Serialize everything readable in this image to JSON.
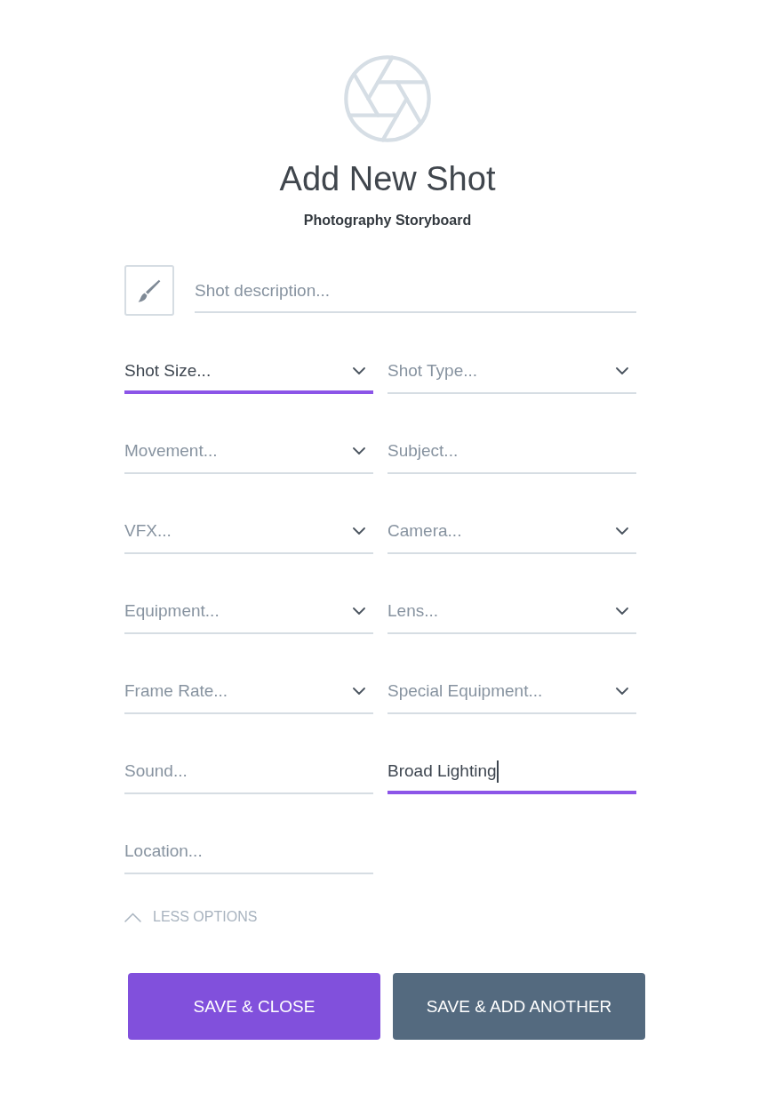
{
  "header": {
    "title": "Add New Shot",
    "subtitle": "Photography Storyboard"
  },
  "description": {
    "placeholder": "Shot description..."
  },
  "fields": [
    {
      "kind": "select",
      "placeholder": "Shot Size...",
      "focused": true
    },
    {
      "kind": "select",
      "placeholder": "Shot Type...",
      "focused": false
    },
    {
      "kind": "select",
      "placeholder": "Movement...",
      "focused": false
    },
    {
      "kind": "text",
      "placeholder": "Subject...",
      "focused": false
    },
    {
      "kind": "select",
      "placeholder": "VFX...",
      "focused": false
    },
    {
      "kind": "select",
      "placeholder": "Camera...",
      "focused": false
    },
    {
      "kind": "select",
      "placeholder": "Equipment...",
      "focused": false
    },
    {
      "kind": "select",
      "placeholder": "Lens...",
      "focused": false
    },
    {
      "kind": "select",
      "placeholder": "Frame Rate...",
      "focused": false
    },
    {
      "kind": "select",
      "placeholder": "Special Equipment...",
      "focused": false
    },
    {
      "kind": "text",
      "placeholder": "Sound...",
      "focused": false
    },
    {
      "kind": "text",
      "value": "Broad Lighting",
      "focused": true
    },
    {
      "kind": "text",
      "placeholder": "Location...",
      "focused": false
    }
  ],
  "toggle": {
    "label": "LESS OPTIONS",
    "expanded": true
  },
  "buttons": [
    {
      "label": "SAVE & CLOSE",
      "kind": "primary"
    },
    {
      "label": "SAVE & ADD ANOTHER",
      "kind": "secondary"
    }
  ]
}
